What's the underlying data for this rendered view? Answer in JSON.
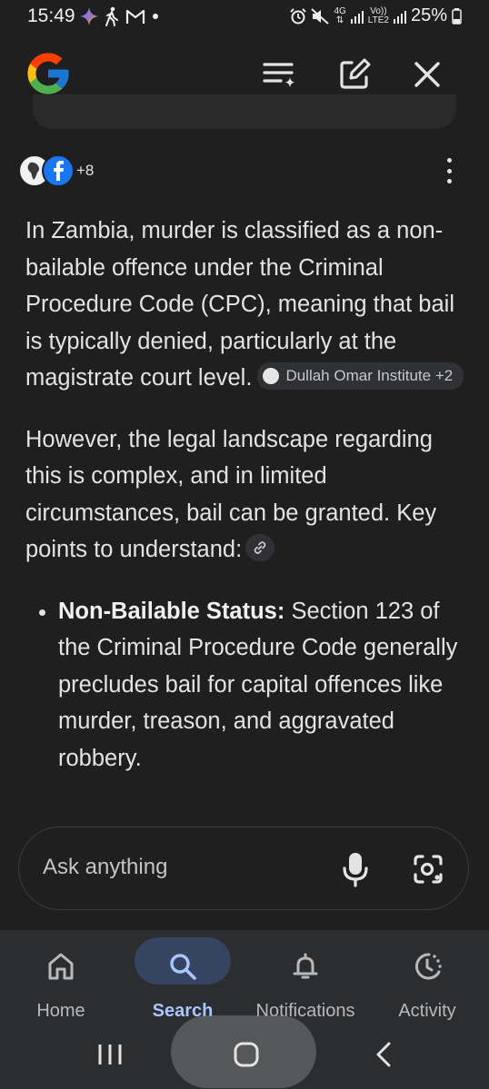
{
  "status_bar": {
    "time": "15:49",
    "network_top": "4G",
    "network_lte_top": "Vo))",
    "network_lte_bottom": "LTE2",
    "battery": "25%"
  },
  "top_bar": {
    "logo": "google-g-logo",
    "filter_icon": "filter-sparkle-icon",
    "edit_icon": "edit-icon",
    "close_icon": "close-icon"
  },
  "sources": {
    "count_label": "+8"
  },
  "answer": {
    "para1": "In Zambia, murder is classified as a non-bailable offence under the Criminal Procedure Code (CPC), meaning that bail is typically denied, particularly at the magistrate court level.",
    "chip1": "Dullah Omar Institute +2",
    "para2": "However, the legal landscape regarding this is complex, and in limited circumstances, bail can be granted. Key points to understand:",
    "bullet1_title": "Non-Bailable Status:",
    "bullet1_text": " Section 123 of the Criminal Procedure Code generally precludes bail for capital offences like murder, treason, and aggravated robbery."
  },
  "ask_bar": {
    "placeholder": "Ask anything"
  },
  "bottom_nav": {
    "items": [
      {
        "label": "Home",
        "icon": "home-icon"
      },
      {
        "label": "Search",
        "icon": "search-icon"
      },
      {
        "label": "Notifications",
        "icon": "bell-icon"
      },
      {
        "label": "Activity",
        "icon": "activity-icon"
      }
    ],
    "active": "Search"
  },
  "colors": {
    "background": "#1f1f1f",
    "accent": "#a8c7fa",
    "active_pill": "#354460"
  }
}
